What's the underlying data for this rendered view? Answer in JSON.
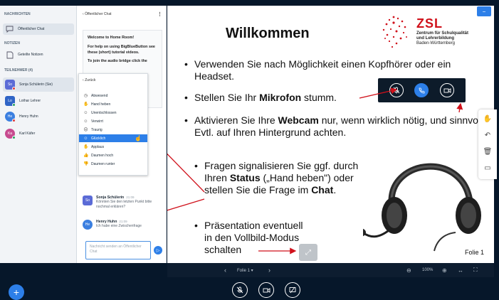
{
  "sidebar": {
    "messages_title": "NACHRICHTEN",
    "public_chat": "Öffentlicher Chat",
    "notes_title": "NOTIZEN",
    "shared_notes": "Geteilte Notizen",
    "participants_title": "TEILNEHMER (4)",
    "users": [
      {
        "initials": "So",
        "name": "Sonja Schülerin (Sie)",
        "color": "#5b6bd6",
        "status": "#e23b3b"
      },
      {
        "initials": "Lo",
        "name": "Lothar Lehrer",
        "color": "#2f64c6",
        "status": "#27a35f"
      },
      {
        "initials": "He",
        "name": "Henry Huhn",
        "color": "#3b7fe0",
        "status": "#e23b3b"
      },
      {
        "initials": "Ka",
        "name": "Karl Käfer",
        "color": "#c74a8f",
        "status": "#27a35f"
      }
    ]
  },
  "chat": {
    "header": "Öffentlicher Chat",
    "welcome_title": "Welcome to Home Room!",
    "welcome_help": "For help on using BigBlueButton see these (short) tutorial videos.",
    "welcome_audio": "To join the audio bridge click the",
    "messages": [
      {
        "initials": "So",
        "name": "Sonja Schülerin",
        "time": "21:09",
        "text": "Könnten Sie den letzten Punkt bitte nochmal erklären?"
      },
      {
        "initials": "He",
        "name": "Henry Huhn",
        "time": "21:09",
        "text": "Ich habe eine Zwischenfrage"
      }
    ],
    "input_placeholder": "Nachricht senden an Öffentlicher Chat"
  },
  "status_menu": {
    "back": "Zurück",
    "items": [
      "Abwesend",
      "Hand heben",
      "Unentschlossen",
      "Verwirrt",
      "Traurig",
      "Glücklich",
      "Applaus",
      "Daumen hoch",
      "Daumen runter"
    ],
    "selected_index": 5
  },
  "slide": {
    "title": "Willkommen",
    "logo_name": "ZSL",
    "logo_sub1": "Zentrum für Schulqualität",
    "logo_sub2": "und Lehrerbildung",
    "logo_sub3": "Baden-Württemberg",
    "bullet1": "Verwenden Sie nach Möglichkeit einen Kopfhörer oder ein Headset.",
    "bullet2_pre": "Stellen Sie Ihr ",
    "bullet2_bold": "Mikrofon",
    "bullet2_post": " stumm.",
    "bullet3_pre": "Aktivieren Sie Ihre ",
    "bullet3_bold": "Webcam",
    "bullet3_post": " nur, wenn wirklich nötig, und sinnvoll! Evtl. auf Ihren Hintergrund achten.",
    "bullet4_a": "Fragen signalisieren Sie ggf. durch Ihren ",
    "bullet4_b": "Status",
    "bullet4_c": " („Hand heben\") oder stellen Sie die Frage im ",
    "bullet4_d": "Chat",
    "bullet4_e": ".",
    "bullet5": "Präsentation eventuell in den Vollbild-Modus schalten",
    "slide_label": "Folie 1"
  },
  "presentation_bar": {
    "slide_select": "Folie 1",
    "zoom": "100%"
  }
}
